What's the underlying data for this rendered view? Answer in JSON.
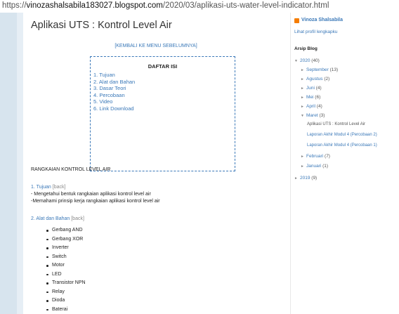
{
  "url": {
    "prefix": "https://",
    "host": "vinozashalsabila183027.blogspot.com",
    "path": "/2020/03/aplikasi-uts-water-level-indicator.html"
  },
  "post": {
    "title": "Aplikasi UTS : Kontrol Level Air",
    "menu_link": "[KEMBALI KE MENU SEBELUMNYA]",
    "toc": {
      "title": "DAFTAR ISI",
      "items": [
        "1. Tujuan",
        "2. Alat dan Bahan",
        "3. Dasar Teori",
        "4. Percobaan",
        "5. Video",
        "6. Link Download"
      ]
    },
    "section_heading": "RANGKAIAN KONTROL LEVEL AIR",
    "tujuan": {
      "number": "1.",
      "label": "Tujuan",
      "back": "[back]",
      "lines": [
        "- Mengetahui bentuk rangkaian aplikasi kontrol level air",
        "-Memahami prinsip kerja rangkaian aplikasi kontrol level air"
      ]
    },
    "alat": {
      "number": "2.",
      "label": "Alat dan Bahan",
      "back": "[back]",
      "items": [
        "Gerbang AND",
        "Gerbang XOR",
        "Inverter",
        "Switch",
        "Motor",
        "LED",
        "Transistor NPN",
        "Relay",
        "Dioda",
        "Baterai"
      ]
    }
  },
  "sidebar": {
    "profile_name": "Vinoza Shalsabila",
    "profile_link": "Lihat profil lengkapku",
    "archive_title": "Arsip Blog",
    "year_2020": "2020",
    "year_2020_count": "(40)",
    "months": [
      {
        "name": "September",
        "count": "(13)"
      },
      {
        "name": "Agustus",
        "count": "(2)"
      },
      {
        "name": "Juni",
        "count": "(4)"
      },
      {
        "name": "Mei",
        "count": "(6)"
      },
      {
        "name": "April",
        "count": "(4)"
      }
    ],
    "maret": {
      "name": "Maret",
      "count": "(3)"
    },
    "maret_posts": [
      "Aplikasi UTS : Kontrol Level Air",
      "Laporan Akhir Modul 4 (Percobaan 2)",
      "Laporan Akhir Modul 4 (Percobaan 1)"
    ],
    "later_months": [
      {
        "name": "Februari",
        "count": "(7)"
      },
      {
        "name": "Januari",
        "count": "(1)"
      }
    ],
    "year_2019": "2019",
    "year_2019_count": "(9)"
  }
}
